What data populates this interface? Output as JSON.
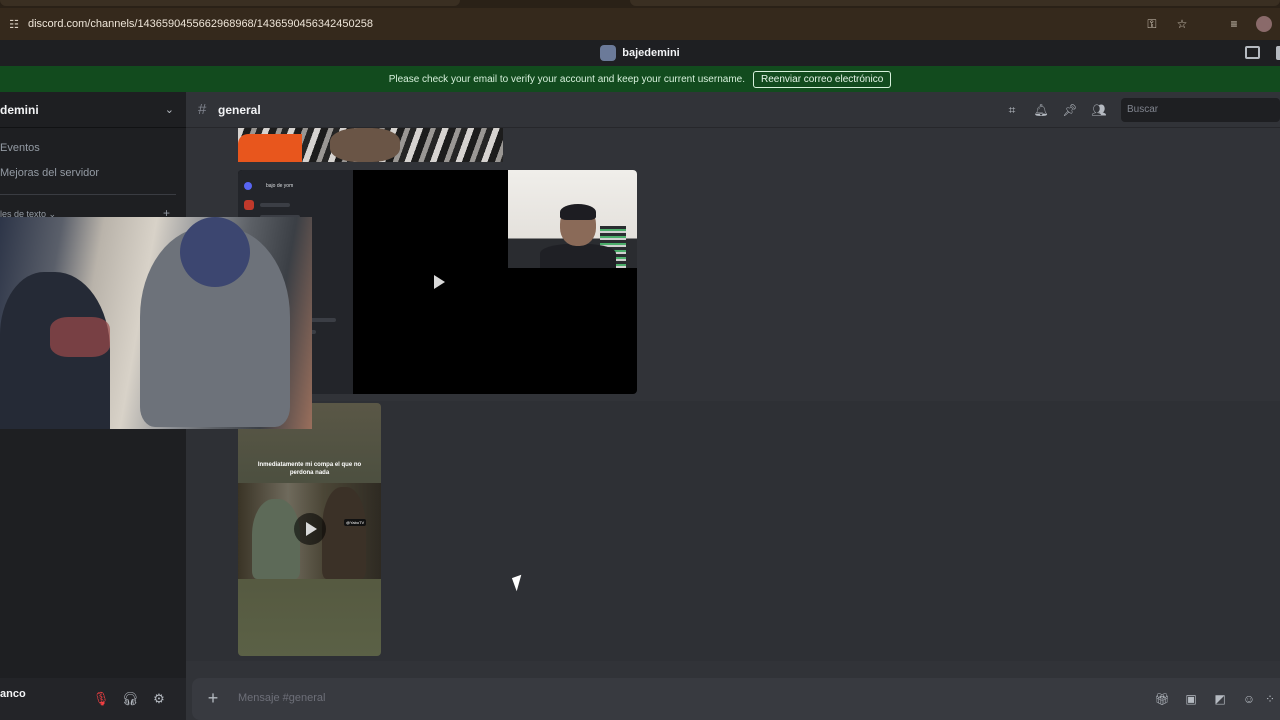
{
  "browser": {
    "url": "discord.com/channels/1436590455662968968/1436590456342450258"
  },
  "titlebar": {
    "server_name": "bajedemini"
  },
  "banner": {
    "message": "Please check your email to verify your account and keep your current username.",
    "button_label": "Reenviar correo electrónico"
  },
  "sidebar": {
    "guild_name": "demini",
    "items": [
      {
        "label": "Eventos"
      },
      {
        "label": "Mejoras del servidor"
      }
    ],
    "category_label": "les de texto ⌄",
    "user": {
      "name": "anco"
    }
  },
  "channel": {
    "name": "general",
    "search_placeholder": "Buscar"
  },
  "messages": {
    "video2_caption": "Inmediatamente mi compa el que no perdona nada",
    "video2_tag": "@YaboTV",
    "video1_inner_label": "bajo de yom"
  },
  "composer": {
    "placeholder": "Mensaje #general"
  },
  "colors": {
    "banner_bg": "#124b1e",
    "chat_bg": "#313338",
    "sidebar_bg": "#1e1f22",
    "mute_red": "#f23f42"
  }
}
